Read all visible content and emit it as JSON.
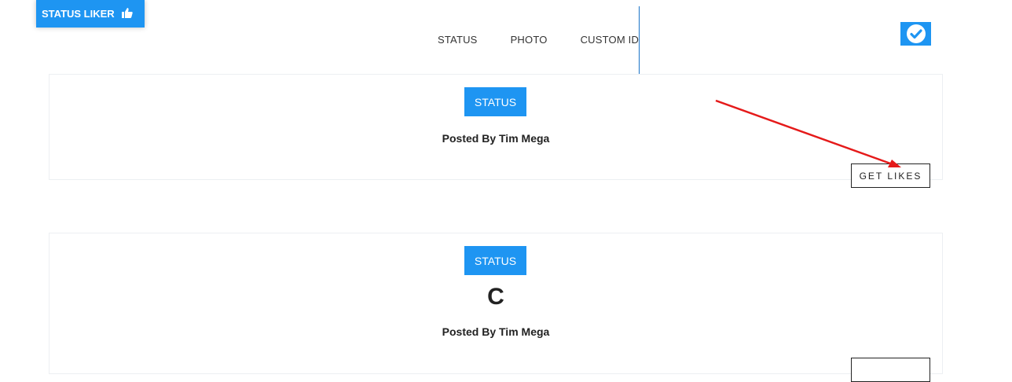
{
  "header": {
    "logo_text": "STATUS LIKER",
    "logo_icon": "thumbs-up-icon",
    "nav": [
      "STATUS",
      "PHOTO",
      "CUSTOM ID"
    ],
    "verified_icon": "check-circle-icon"
  },
  "posts": [
    {
      "badge": "STATUS",
      "content": "",
      "posted_by": "Posted By Tim Mega",
      "button": "GET LIKES"
    },
    {
      "badge": "STATUS",
      "content": "C",
      "posted_by": "Posted By Tim Mega",
      "button": ""
    }
  ],
  "colors": {
    "accent": "#1e95f2",
    "annotation_arrow": "#e51a1a"
  }
}
